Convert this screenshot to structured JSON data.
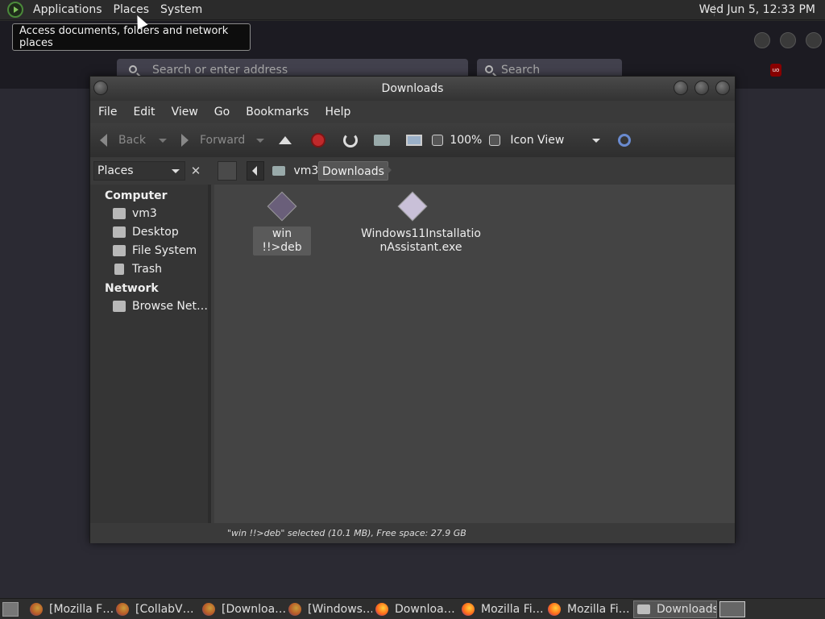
{
  "top_panel": {
    "menus": [
      "Applications",
      "Places",
      "System"
    ],
    "clock": "Wed Jun  5, 12:33 PM"
  },
  "tooltip": "Access documents, folders and network places",
  "firefox": {
    "url_placeholder": "Search or enter address",
    "search_placeholder": "Search"
  },
  "window": {
    "title": "Downloads",
    "menu": [
      "File",
      "Edit",
      "View",
      "Go",
      "Bookmarks",
      "Help"
    ],
    "toolbar": {
      "back": "Back",
      "forward": "Forward",
      "zoom": "100%",
      "view_mode": "Icon View"
    },
    "sidebar_selector": "Places",
    "breadcrumb": [
      "vm3",
      "Downloads"
    ],
    "sidebar": {
      "computer_heading": "Computer",
      "computer_items": [
        "vm3",
        "Desktop",
        "File System",
        "Trash"
      ],
      "network_heading": "Network",
      "network_items": [
        "Browse Net…"
      ]
    },
    "files": [
      {
        "name": "win !!>deb",
        "selected": true,
        "color": "#6a5f7a"
      },
      {
        "name": "Windows11Installatio\nnAssistant.exe",
        "selected": false,
        "color": "#c9c0d8"
      }
    ],
    "status": "\"win !!>deb\" selected (10.1 MB), Free space: 27.9 GB"
  },
  "taskbar": {
    "tasks": [
      {
        "label": "[Mozilla F…",
        "icon": "firefox-icon"
      },
      {
        "label": "[CollabV…",
        "icon": "firefox-icon"
      },
      {
        "label": "[Downloa…",
        "icon": "firefox-icon"
      },
      {
        "label": "[Windows…",
        "icon": "firefox-icon"
      },
      {
        "label": "Downloa…",
        "icon": "firefox-icon"
      },
      {
        "label": "Mozilla Fi…",
        "icon": "firefox-icon"
      },
      {
        "label": "Mozilla Fi…",
        "icon": "firefox-icon"
      },
      {
        "label": "Downloads",
        "icon": "folder-icon",
        "active": true
      }
    ]
  }
}
